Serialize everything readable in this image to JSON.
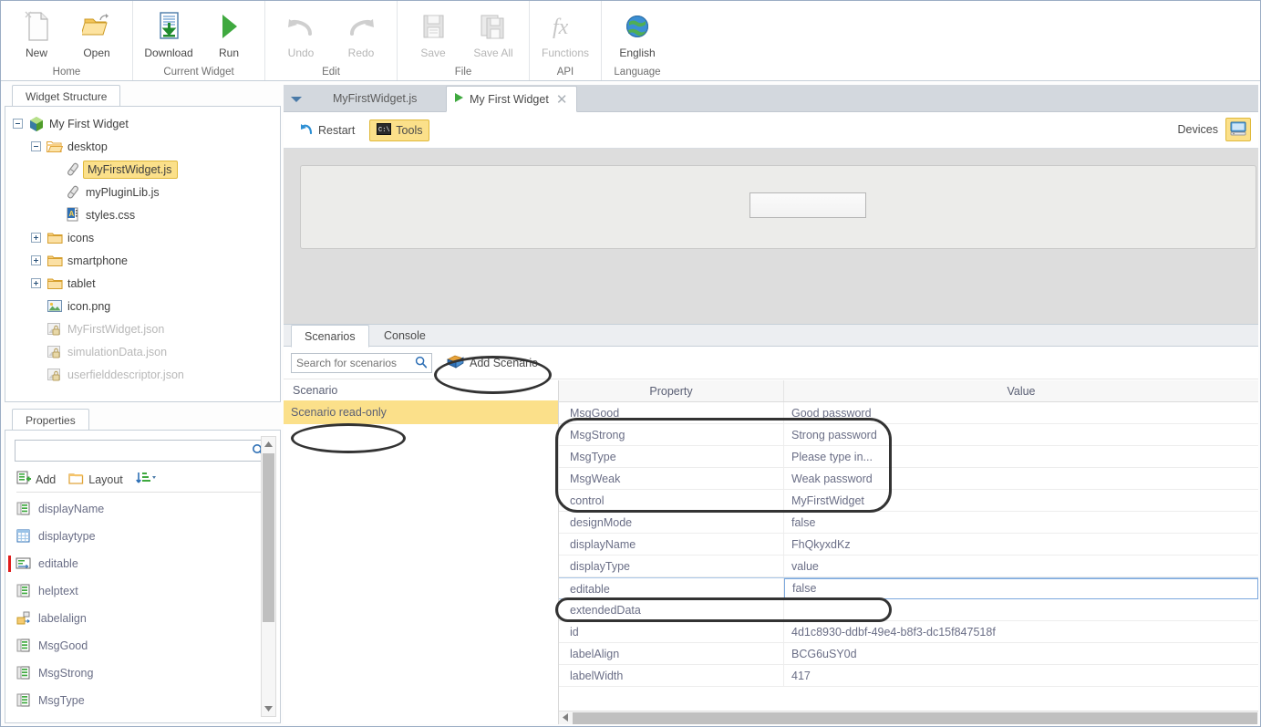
{
  "ribbon": {
    "groups": [
      {
        "label": "Home",
        "buttons": [
          {
            "label": "New",
            "icon": "new-document-icon",
            "disabled": false
          },
          {
            "label": "Open",
            "icon": "open-folder-icon",
            "disabled": false
          }
        ]
      },
      {
        "label": "Current Widget",
        "buttons": [
          {
            "label": "Download",
            "icon": "download-icon",
            "disabled": false
          },
          {
            "label": "Run",
            "icon": "run-play-icon",
            "disabled": false
          }
        ]
      },
      {
        "label": "Edit",
        "buttons": [
          {
            "label": "Undo",
            "icon": "undo-arrow-icon",
            "disabled": true
          },
          {
            "label": "Redo",
            "icon": "redo-arrow-icon",
            "disabled": true
          }
        ]
      },
      {
        "label": "File",
        "buttons": [
          {
            "label": "Save",
            "icon": "save-floppy-icon",
            "disabled": true
          },
          {
            "label": "Save All",
            "icon": "save-all-icon",
            "disabled": true
          }
        ]
      },
      {
        "label": "API",
        "buttons": [
          {
            "label": "Functions",
            "icon": "fx-function-icon",
            "disabled": true
          }
        ]
      },
      {
        "label": "Language",
        "buttons": [
          {
            "label": "English",
            "icon": "globe-icon",
            "disabled": false
          }
        ]
      }
    ]
  },
  "structure_pane": {
    "tab_label": "Widget Structure",
    "tree": [
      {
        "label": "My First Widget",
        "icon": "widget-cube-icon",
        "depth": 0,
        "expander": "minus",
        "selected": false,
        "dim": false
      },
      {
        "label": "desktop",
        "icon": "folder-open-icon",
        "depth": 1,
        "expander": "minus",
        "selected": false,
        "dim": false
      },
      {
        "label": "MyFirstWidget.js",
        "icon": "js-file-icon",
        "depth": 2,
        "expander": "none",
        "selected": true,
        "dim": false
      },
      {
        "label": "myPluginLib.js",
        "icon": "js-file-icon",
        "depth": 2,
        "expander": "none",
        "selected": false,
        "dim": false
      },
      {
        "label": "styles.css",
        "icon": "css-file-icon",
        "depth": 2,
        "expander": "none",
        "selected": false,
        "dim": false
      },
      {
        "label": "icons",
        "icon": "folder-icon",
        "depth": 1,
        "expander": "plus",
        "selected": false,
        "dim": false
      },
      {
        "label": "smartphone",
        "icon": "folder-icon",
        "depth": 1,
        "expander": "plus",
        "selected": false,
        "dim": false
      },
      {
        "label": "tablet",
        "icon": "folder-icon",
        "depth": 1,
        "expander": "plus",
        "selected": false,
        "dim": false
      },
      {
        "label": "icon.png",
        "icon": "image-file-icon",
        "depth": 1,
        "expander": "none",
        "selected": false,
        "dim": false
      },
      {
        "label": "MyFirstWidget.json",
        "icon": "locked-json-icon",
        "depth": 1,
        "expander": "none",
        "selected": false,
        "dim": true
      },
      {
        "label": "simulationData.json",
        "icon": "locked-json-icon",
        "depth": 1,
        "expander": "none",
        "selected": false,
        "dim": true
      },
      {
        "label": "userfielddescriptor.json",
        "icon": "locked-json-icon",
        "depth": 1,
        "expander": "none",
        "selected": false,
        "dim": true
      }
    ]
  },
  "properties_pane": {
    "tab_label": "Properties",
    "search_value": "",
    "search_placeholder": "",
    "toolbar": [
      {
        "label": "Add",
        "icon": "add-property-icon"
      },
      {
        "label": "Layout",
        "icon": "layout-folder-icon"
      },
      {
        "label": "",
        "icon": "sort-ascending-icon"
      }
    ],
    "items": [
      {
        "label": "displayName",
        "icon": "text-property-icon",
        "marked": false
      },
      {
        "label": "displaytype",
        "icon": "table-property-icon",
        "marked": false
      },
      {
        "label": "editable",
        "icon": "input-property-icon",
        "marked": true
      },
      {
        "label": "helptext",
        "icon": "text-property-icon",
        "marked": false
      },
      {
        "label": "labelalign",
        "icon": "align-property-icon",
        "marked": false
      },
      {
        "label": "MsgGood",
        "icon": "text-property-icon",
        "marked": false
      },
      {
        "label": "MsgStrong",
        "icon": "text-property-icon",
        "marked": false
      },
      {
        "label": "MsgType",
        "icon": "text-property-icon",
        "marked": false
      }
    ]
  },
  "main": {
    "tabs": {
      "dropdown_icon": "chevron-down-icon",
      "inactive_label": "MyFirstWidget.js",
      "active_label": "My First Widget",
      "active_icon": "run-play-icon",
      "close_icon": "close-icon"
    },
    "run_toolbar": {
      "restart_label": "Restart",
      "restart_icon": "restart-arrow-icon",
      "tools_label": "Tools",
      "tools_icon": "console-icon",
      "devices_label": "Devices",
      "devices_icon": "desktop-monitor-icon"
    },
    "preview": {
      "input_value": "",
      "input_placeholder": ""
    }
  },
  "bottom": {
    "tabs": [
      {
        "label": "Scenarios",
        "active": true
      },
      {
        "label": "Console",
        "active": false
      }
    ],
    "search_value": "",
    "search_placeholder": "Search for scenarios",
    "search_icon": "search-icon",
    "add_scenario_label": "Add Scenario",
    "add_scenario_icon": "add-scenario-box-icon",
    "scenario_column_header": "Scenario",
    "scenarios": [
      {
        "label": "Scenario read-only",
        "selected": true
      }
    ],
    "grid": {
      "headers": [
        "Property",
        "Value"
      ],
      "rows": [
        {
          "property": "MsgGood",
          "value": "Good password",
          "editing": false
        },
        {
          "property": "MsgStrong",
          "value": "Strong password",
          "editing": false
        },
        {
          "property": "MsgType",
          "value": "Please type in...",
          "editing": false
        },
        {
          "property": "MsgWeak",
          "value": "Weak password",
          "editing": false
        },
        {
          "property": "control",
          "value": "MyFirstWidget",
          "editing": false
        },
        {
          "property": "designMode",
          "value": "false",
          "editing": false
        },
        {
          "property": "displayName",
          "value": "FhQkyxdKz",
          "editing": false
        },
        {
          "property": "displayType",
          "value": "value",
          "editing": false
        },
        {
          "property": "editable",
          "value": "false",
          "editing": true
        },
        {
          "property": "extendedData",
          "value": "",
          "editing": false
        },
        {
          "property": "id",
          "value": "4d1c8930-ddbf-49e4-b8f3-dc15f847518f",
          "editing": false
        },
        {
          "property": "labelAlign",
          "value": "BCG6uSY0d",
          "editing": false
        },
        {
          "property": "labelWidth",
          "value": "417",
          "editing": false
        }
      ]
    }
  },
  "colors": {
    "highlight_yellow": "#fbe08a",
    "highlight_border": "#e0b93b",
    "annotation_stroke": "#333333",
    "accent_blue": "#7ba7dd",
    "ribbon_bg": "#ffffff",
    "preview_bg": "#dddddd"
  },
  "annotations": [
    {
      "name": "annotation-add-scenario"
    },
    {
      "name": "annotation-scenario-readonly"
    },
    {
      "name": "annotation-msg-rows"
    },
    {
      "name": "annotation-editable-row"
    }
  ]
}
